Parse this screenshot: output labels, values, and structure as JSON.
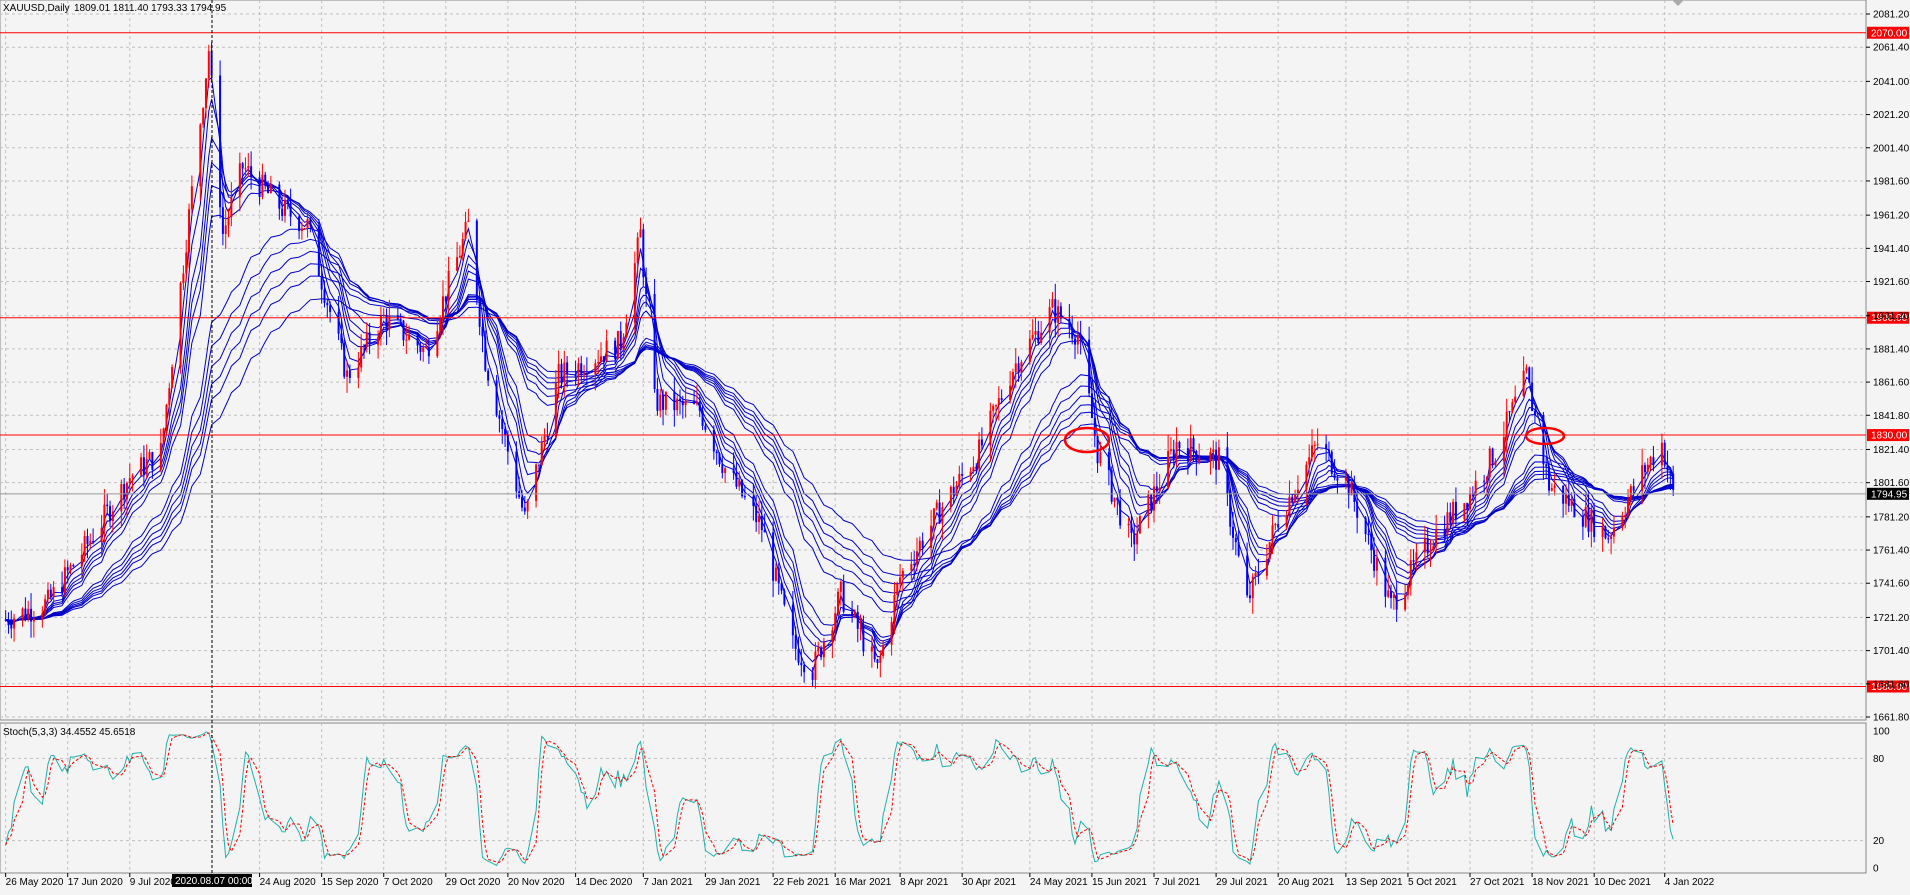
{
  "window": {
    "title": "XAUUSD,Daily",
    "ohlc": "1809.01 1811.40 1793.33 1794.95"
  },
  "indicator": {
    "title": "Stoch(5,3,3) 34.4552 45.6518",
    "levels": [
      100,
      80,
      20,
      0
    ],
    "k_color": "#20b2aa",
    "d_color": "#ff0000"
  },
  "crosshair": {
    "date_label": "2020.08.07 00:00"
  },
  "colors": {
    "background": "#f4f4f4",
    "grid": "#c0c0c0",
    "bull": "#ff0000",
    "bear": "#0000ff",
    "ribbon": "#0000c8",
    "level_line": "#ff0000",
    "current_price_bg": "#000000"
  },
  "chart_data": {
    "type": "candlestick",
    "symbol": "XAUUSD",
    "timeframe": "Daily",
    "ylim": [
      1661.8,
      2081.2
    ],
    "price_ticks": [
      "2081.20",
      "2061.40",
      "2041.00",
      "2021.20",
      "2001.40",
      "1981.60",
      "1961.20",
      "1941.40",
      "1921.60",
      "1901.20",
      "1881.40",
      "1861.60",
      "1841.80",
      "1821.40",
      "1801.60",
      "1781.20",
      "1761.40",
      "1741.60",
      "1721.20",
      "1701.40",
      "1681.60",
      "1661.80"
    ],
    "date_ticks": [
      "26 May 2020",
      "17 Jun 2020",
      "9 Jul 2020",
      "24 Aug 2020",
      "15 Sep 2020",
      "7 Oct 2020",
      "29 Oct 2020",
      "20 Nov 2020",
      "14 Dec 2020",
      "7 Jan 2021",
      "29 Jan 2021",
      "22 Feb 2021",
      "16 Mar 2021",
      "8 Apr 2021",
      "30 Apr 2021",
      "24 May 2021",
      "15 Jun 2021",
      "7 Jul 2021",
      "29 Jul 2021",
      "20 Aug 2021",
      "13 Sep 2021",
      "5 Oct 2021",
      "27 Oct 2021",
      "18 Nov 2021",
      "10 Dec 2021",
      "4 Jan 2022"
    ],
    "levels": [
      {
        "price": 2070.0,
        "label": "2070.00"
      },
      {
        "price": 1900.0,
        "label": "1900.00"
      },
      {
        "price": 1830.0,
        "label": "1830.00"
      },
      {
        "price": 1680.0,
        "label": "1680.00"
      }
    ],
    "current_price": {
      "price": 1794.95,
      "label": "1794.95"
    },
    "anchors": [
      [
        "2020-05-26",
        1720
      ],
      [
        "2020-06-10",
        1730
      ],
      [
        "2020-06-24",
        1765
      ],
      [
        "2020-07-09",
        1805
      ],
      [
        "2020-07-20",
        1820
      ],
      [
        "2020-07-31",
        1975
      ],
      [
        "2020-08-06",
        2060
      ],
      [
        "2020-08-11",
        1950
      ],
      [
        "2020-08-18",
        1990
      ],
      [
        "2020-09-01",
        1965
      ],
      [
        "2020-09-10",
        1955
      ],
      [
        "2020-09-24",
        1865
      ],
      [
        "2020-10-07",
        1900
      ],
      [
        "2020-10-22",
        1880
      ],
      [
        "2020-11-06",
        1955
      ],
      [
        "2020-11-12",
        1875
      ],
      [
        "2020-11-26",
        1780
      ],
      [
        "2020-12-08",
        1865
      ],
      [
        "2020-12-30",
        1885
      ],
      [
        "2021-01-06",
        1950
      ],
      [
        "2021-01-11",
        1850
      ],
      [
        "2021-01-27",
        1845
      ],
      [
        "2021-02-05",
        1810
      ],
      [
        "2021-02-18",
        1775
      ],
      [
        "2021-03-01",
        1705
      ],
      [
        "2021-03-08",
        1690
      ],
      [
        "2021-03-18",
        1735
      ],
      [
        "2021-03-31",
        1690
      ],
      [
        "2021-04-08",
        1745
      ],
      [
        "2021-04-22",
        1785
      ],
      [
        "2021-05-06",
        1820
      ],
      [
        "2021-05-18",
        1870
      ],
      [
        "2021-06-01",
        1905
      ],
      [
        "2021-06-10",
        1890
      ],
      [
        "2021-06-17",
        1820
      ],
      [
        "2021-06-29",
        1765
      ],
      [
        "2021-07-15",
        1825
      ],
      [
        "2021-07-30",
        1815
      ],
      [
        "2021-08-09",
        1730
      ],
      [
        "2021-08-20",
        1780
      ],
      [
        "2021-09-03",
        1825
      ],
      [
        "2021-09-14",
        1800
      ],
      [
        "2021-09-29",
        1728
      ],
      [
        "2021-10-14",
        1770
      ],
      [
        "2021-10-27",
        1795
      ],
      [
        "2021-11-05",
        1820
      ],
      [
        "2021-11-16",
        1865
      ],
      [
        "2021-11-24",
        1800
      ],
      [
        "2021-12-15",
        1770
      ],
      [
        "2021-12-28",
        1810
      ],
      [
        "2022-01-03",
        1825
      ],
      [
        "2022-01-07",
        1795
      ]
    ]
  }
}
